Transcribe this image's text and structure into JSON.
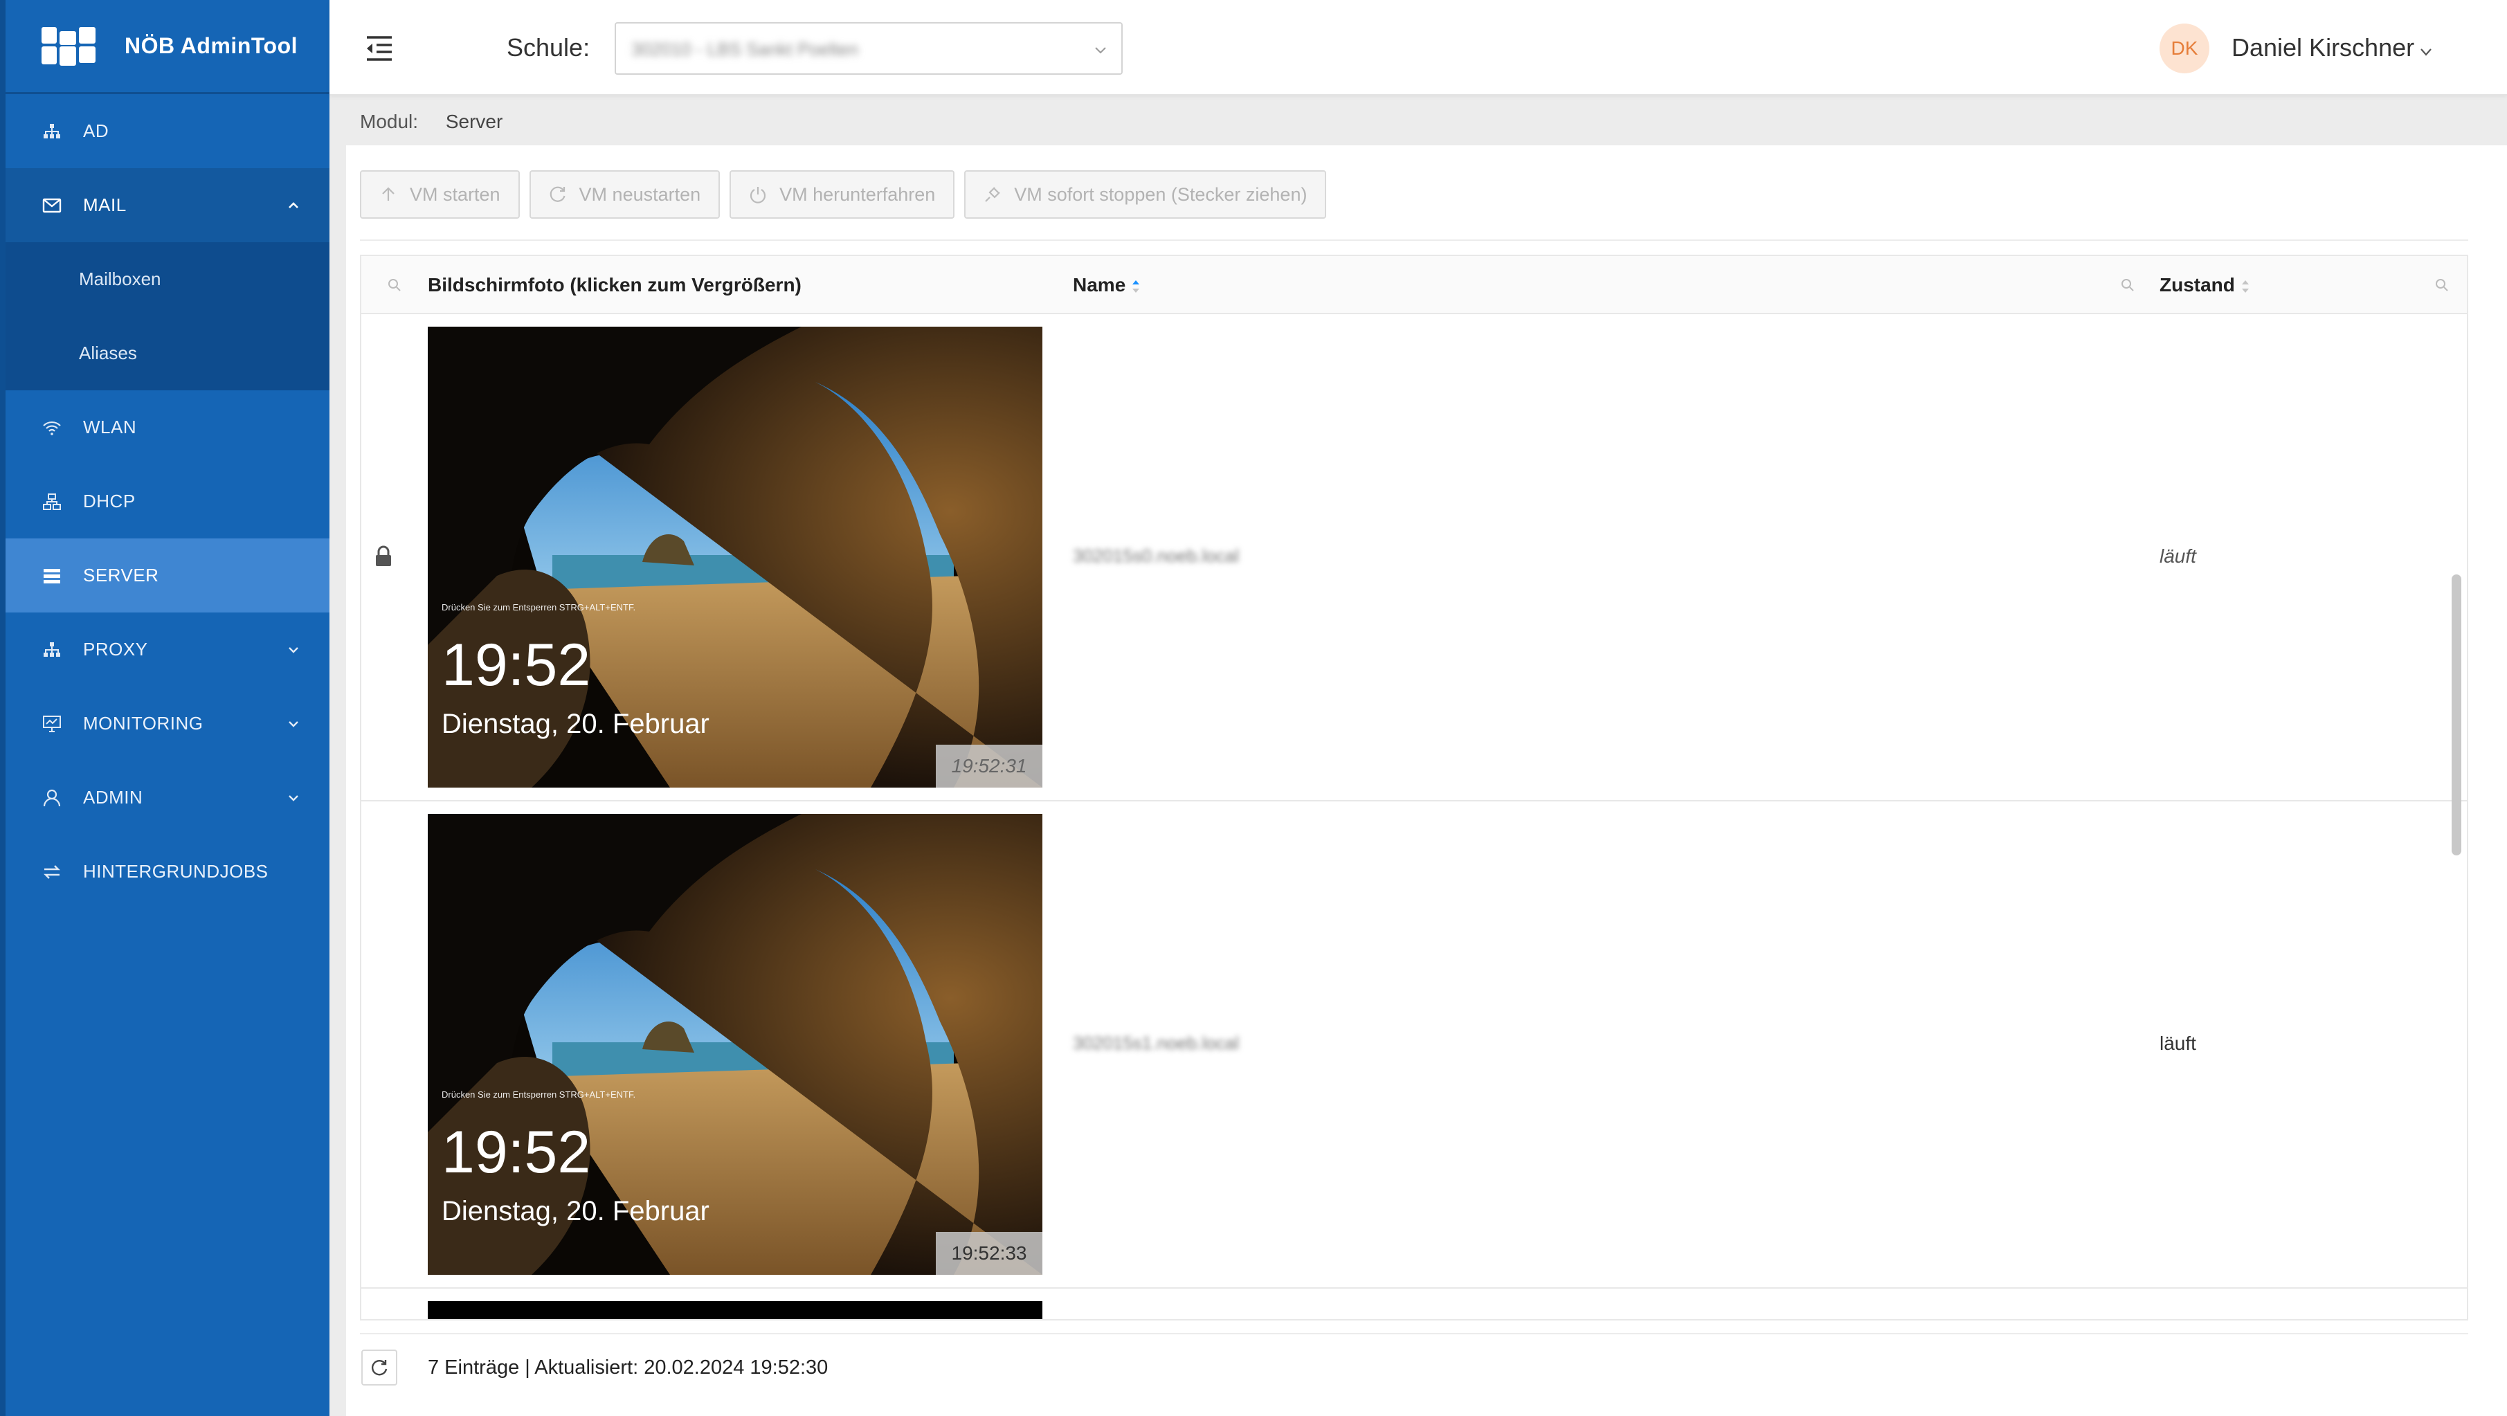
{
  "app": {
    "title": "NÖB AdminTool"
  },
  "sidebar": {
    "items": [
      {
        "label": "AD",
        "icon": "sitemap-icon"
      },
      {
        "label": "MAIL",
        "icon": "mail-icon",
        "expanded": true,
        "children": [
          {
            "label": "Mailboxen"
          },
          {
            "label": "Aliases"
          }
        ]
      },
      {
        "label": "WLAN",
        "icon": "wifi-icon"
      },
      {
        "label": "DHCP",
        "icon": "network-icon"
      },
      {
        "label": "SERVER",
        "icon": "server-icon",
        "active": true
      },
      {
        "label": "PROXY",
        "icon": "sitemap-icon"
      },
      {
        "label": "MONITORING",
        "icon": "monitor-icon"
      },
      {
        "label": "ADMIN",
        "icon": "user-icon"
      },
      {
        "label": "HINTERGRUNDJOBS",
        "icon": "swap-icon"
      }
    ]
  },
  "header": {
    "school_label": "Schule:",
    "school_value": "302010 - LBS Sankt Poelten",
    "user_initials": "DK",
    "user_name": "Daniel Kirschner"
  },
  "breadcrumb": {
    "label": "Modul:",
    "value": "Server"
  },
  "toolbar": {
    "buttons": [
      {
        "label": "VM starten",
        "icon": "arrow-up-icon"
      },
      {
        "label": "VM neustarten",
        "icon": "reload-icon"
      },
      {
        "label": "VM herunterfahren",
        "icon": "power-icon"
      },
      {
        "label": "VM sofort stoppen (Stecker ziehen)",
        "icon": "plug-icon"
      }
    ]
  },
  "table": {
    "columns": [
      {
        "label": "Bildschirmfoto (klicken zum Vergrößern)"
      },
      {
        "label": "Name",
        "sorted": "asc"
      },
      {
        "label": "Zustand"
      }
    ],
    "rows": [
      {
        "locked": true,
        "screenshot": {
          "hint": "Drücken Sie zum Entsperren STRG+ALT+ENTF.",
          "time": "19:52",
          "date": "Dienstag, 20. Februar",
          "stamp": "19:52:31"
        },
        "name": "302015s0.noeb.local",
        "state": "läuft"
      },
      {
        "locked": false,
        "screenshot": {
          "hint": "Drücken Sie zum Entsperren STRG+ALT+ENTF.",
          "time": "19:52",
          "date": "Dienstag, 20. Februar",
          "stamp": "19:52:33"
        },
        "name": "302015s1.noeb.local",
        "state": "läuft"
      }
    ]
  },
  "footer": {
    "entries": "7 Einträge",
    "separator": "|",
    "updated": "Aktualisiert: 20.02.2024 19:52:30"
  },
  "colors": {
    "sidebar": "#1565b5",
    "sidebar_active": "#3f86d2",
    "submenu": "#0e4c8e",
    "accent": "#1890ff",
    "avatar_bg": "#fde3d1",
    "avatar_fg": "#e67e3a"
  }
}
